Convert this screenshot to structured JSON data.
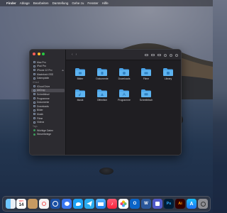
{
  "menubar": {
    "items": [
      "Finder",
      "Ablage",
      "Bearbeiten",
      "Darstellung",
      "Gehe zu",
      "Fenster",
      "Hilfe"
    ]
  },
  "finder": {
    "sidebar": {
      "locations": [
        {
          "label": "Mac Pro"
        },
        {
          "label": "iPad Pro"
        },
        {
          "label": "iPhone 12 Pro",
          "eject": true
        },
        {
          "label": "Macintosh SSD"
        },
        {
          "label": "Datenplatte"
        }
      ],
      "icloud_section": "iCloud",
      "icloud": [
        {
          "label": "iCloud Drive"
        },
        {
          "label": "AirDrop"
        }
      ],
      "favorites": [
        {
          "label": "Schreibtisch"
        },
        {
          "label": "Programme"
        },
        {
          "label": "Dokumente"
        },
        {
          "label": "Downloads"
        },
        {
          "label": "Bilder"
        },
        {
          "label": "Musik"
        },
        {
          "label": "Filme"
        },
        {
          "label": "Videos"
        }
      ],
      "tags_section": "Tags",
      "tags": [
        {
          "label": "Wichtige Daten"
        },
        {
          "label": "Steuerbelege"
        }
      ]
    },
    "toolbar": {
      "back_glyph": "‹",
      "forward_glyph": "›"
    },
    "folders_row1": [
      "Bilder",
      "Dokumente",
      "Downloads",
      "Filme",
      "Library"
    ],
    "folders_row2": [
      "Musik",
      "Öffentlich",
      "Programme",
      "Schreibtisch"
    ],
    "accent_color": "#4aa3e8"
  },
  "dock": {
    "calendar_month": "OKT.",
    "calendar_day": "14",
    "app_icons": [
      "finder-icon",
      "calendar-icon",
      "contacts-icon",
      "reminders-icon",
      "onepassword-icon",
      "signal-icon",
      "twitter-icon",
      "telegram-icon",
      "mail-icon",
      "music-icon",
      "photos-icon",
      "outlook-icon",
      "word-icon",
      "teams-icon",
      "photoshop-icon",
      "illustrator-icon",
      "appstore-icon",
      "preferences-icon",
      "trash-icon"
    ],
    "app_letters": {
      "photoshop": "Ps",
      "illustrator": "Ai",
      "word": "W",
      "outlook": "O"
    }
  }
}
